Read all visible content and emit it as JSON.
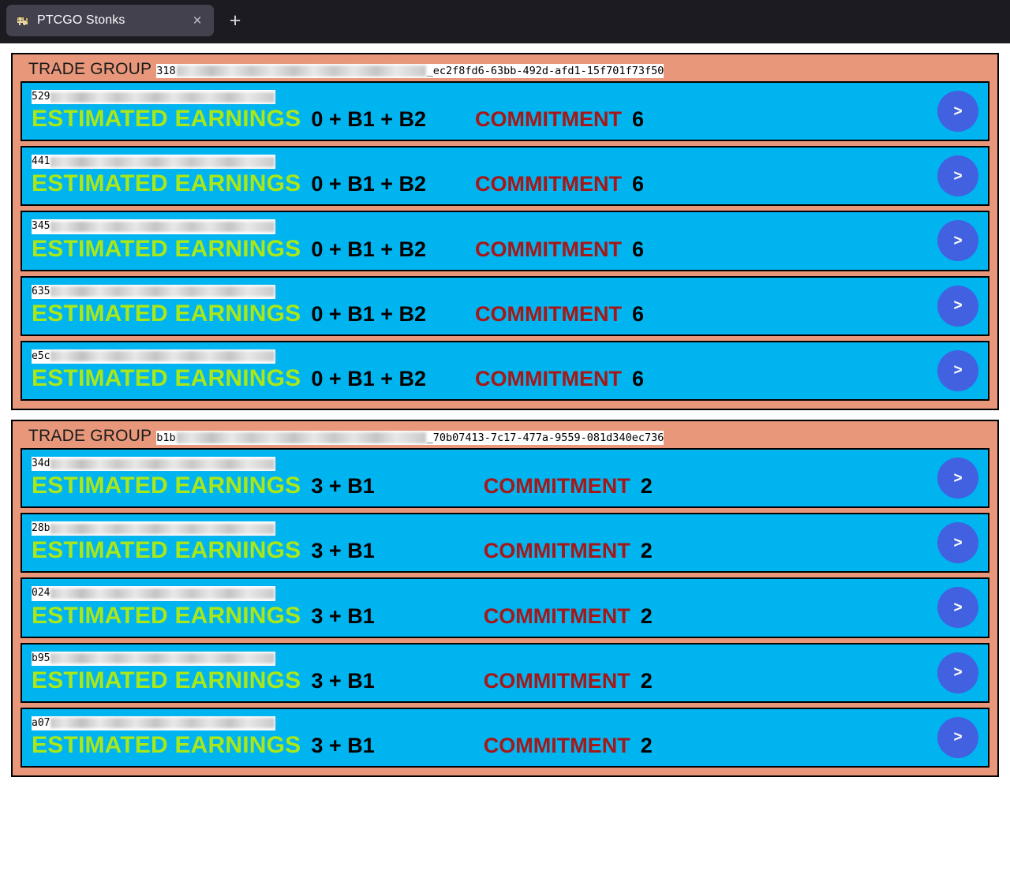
{
  "browser": {
    "tab": {
      "title": "PTCGO Stonks",
      "favicon_name": "cat-favicon",
      "close_label": "×"
    },
    "new_tab_label": "+"
  },
  "colors": {
    "group_background": "#e8977a",
    "card_background": "#00b4f0",
    "earnings_label": "#a8e818",
    "commitment_label": "#a61717",
    "value_text": "#000000",
    "action_button": "#4161e0",
    "chrome_background": "#1c1b22",
    "tab_background": "#42414d",
    "page_background": "#ffffff"
  },
  "labels": {
    "trade_group": "TRADE GROUP",
    "estimated_earnings": "ESTIMATED EARNINGS",
    "commitment": "COMMITMENT",
    "action_arrow": ">"
  },
  "groups": [
    {
      "id_prefix": "318",
      "id_suffix": "_ec2f8fd6-63bb-492d-afd1-15f701f73f50",
      "redacted_width": 316,
      "cards": [
        {
          "id_prefix": "529",
          "redacted_width": 284,
          "earnings": "0 + B1 + B2",
          "commitment": "6"
        },
        {
          "id_prefix": "441",
          "redacted_width": 284,
          "earnings": "0 + B1 + B2",
          "commitment": "6"
        },
        {
          "id_prefix": "345",
          "redacted_width": 284,
          "earnings": "0 + B1 + B2",
          "commitment": "6"
        },
        {
          "id_prefix": "635",
          "redacted_width": 284,
          "earnings": "0 + B1 + B2",
          "commitment": "6"
        },
        {
          "id_prefix": "e5c",
          "redacted_width": 284,
          "earnings": "0 + B1 + B2",
          "commitment": "6"
        }
      ]
    },
    {
      "id_prefix": "b1b",
      "id_suffix": "_70b07413-7c17-477a-9559-081d340ec736",
      "redacted_width": 316,
      "cards": [
        {
          "id_prefix": "34d",
          "redacted_width": 284,
          "earnings": "3 + B1",
          "commitment": "2"
        },
        {
          "id_prefix": "28b",
          "redacted_width": 284,
          "earnings": "3 + B1",
          "commitment": "2"
        },
        {
          "id_prefix": "024",
          "redacted_width": 284,
          "earnings": "3 + B1",
          "commitment": "2"
        },
        {
          "id_prefix": "b95",
          "redacted_width": 284,
          "earnings": "3 + B1",
          "commitment": "2"
        },
        {
          "id_prefix": "a07",
          "redacted_width": 284,
          "earnings": "3 + B1",
          "commitment": "2"
        }
      ]
    }
  ]
}
